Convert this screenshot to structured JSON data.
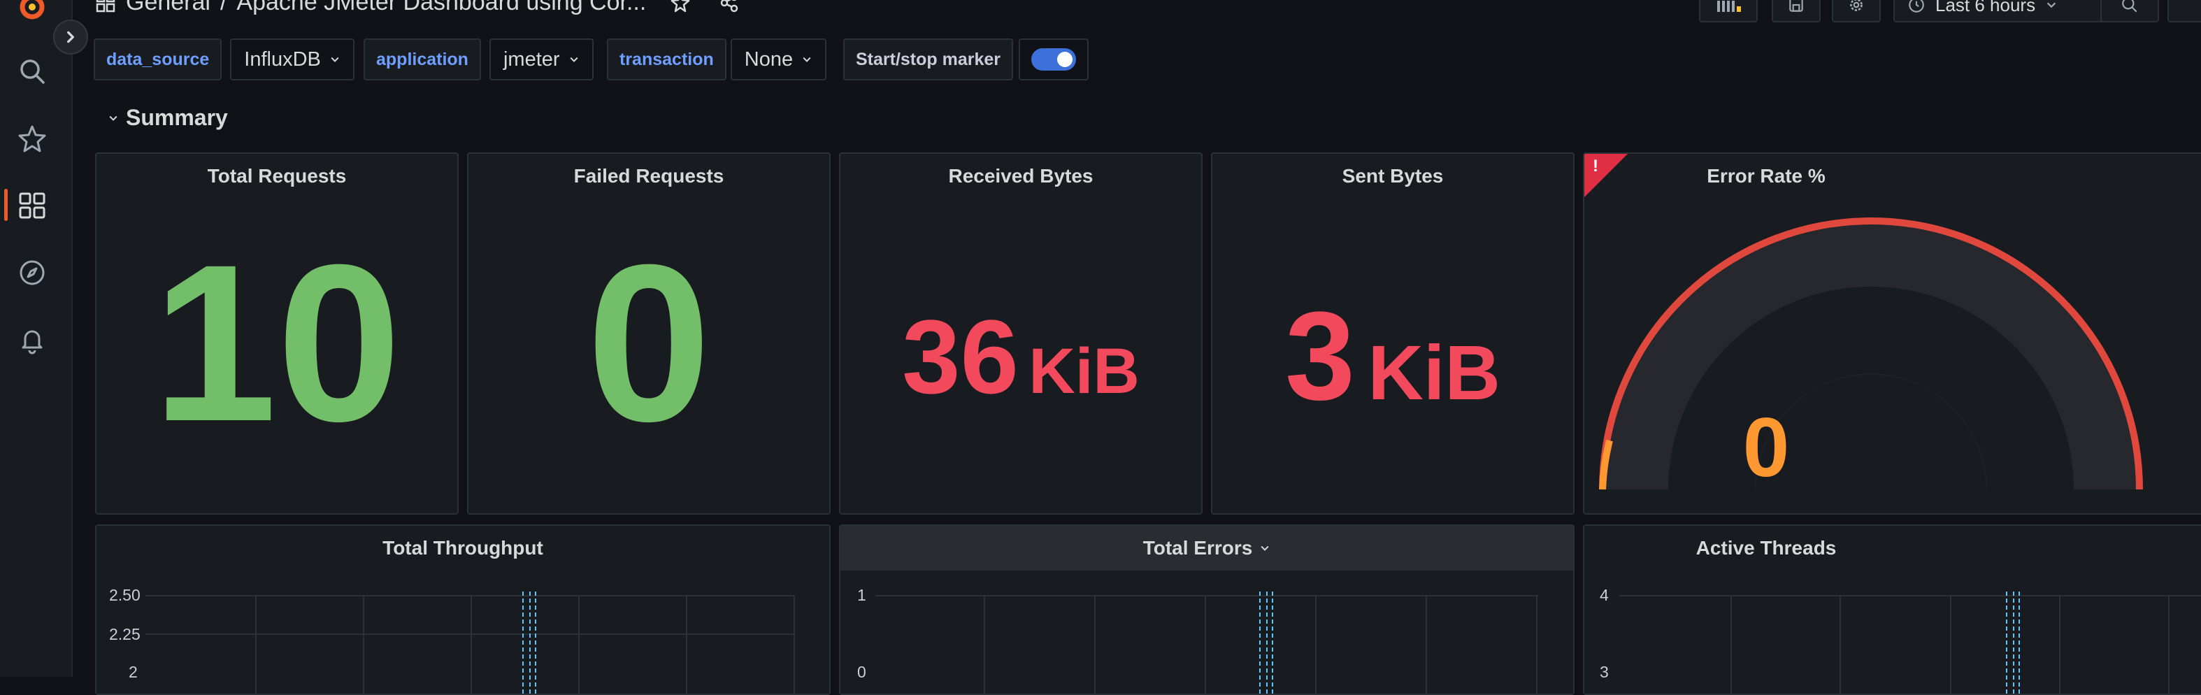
{
  "topbar": {
    "breadcrumb_folder": "General",
    "breadcrumb_sep": "/",
    "breadcrumb_title": "Apache JMeter Dashboard using Cor...",
    "time_range": "Last 6 hours"
  },
  "variables": [
    {
      "label": "data_source",
      "value": "InfluxDB"
    },
    {
      "label": "application",
      "value": "jmeter"
    },
    {
      "label": "transaction",
      "value": "None"
    }
  ],
  "toggle": {
    "label": "Start/stop marker",
    "on": true
  },
  "row": {
    "title": "Summary"
  },
  "stats": {
    "total_requests": {
      "title": "Total Requests",
      "value": "10"
    },
    "failed_requests": {
      "title": "Failed Requests",
      "value": "0"
    },
    "received_bytes": {
      "title": "Received Bytes",
      "value": "36",
      "unit": "KiB"
    },
    "sent_bytes": {
      "title": "Sent Bytes",
      "value": "3",
      "unit": "KiB"
    },
    "error_rate": {
      "title": "Error Rate %",
      "value": "0",
      "gauge_fraction": 0
    }
  },
  "graphs": {
    "throughput": {
      "title": "Total Throughput",
      "ticks": [
        "2.50",
        "2.25",
        "2"
      ]
    },
    "errors": {
      "title": "Total Errors",
      "ticks": [
        "1",
        "0"
      ]
    },
    "threads": {
      "title": "Active Threads",
      "ticks": [
        "4",
        "3"
      ]
    }
  },
  "colors": {
    "green": "#73bf69",
    "red": "#f2495c",
    "orange": "#ff9830",
    "accent": "#3d71d9"
  }
}
